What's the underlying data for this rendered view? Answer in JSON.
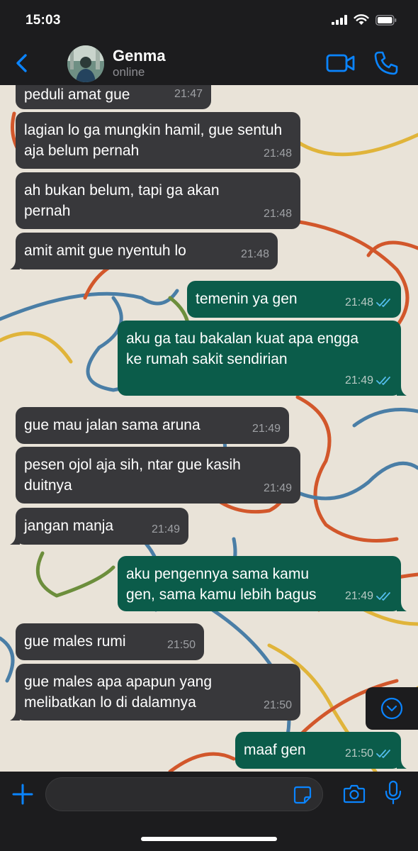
{
  "status_bar": {
    "time": "15:03"
  },
  "header": {
    "contact_name": "Genma",
    "contact_status": "online"
  },
  "messages": [
    {
      "dir": "in",
      "text": "peduli amat gue",
      "time": "21:47"
    },
    {
      "dir": "in",
      "text": "lagian lo ga mungkin hamil, gue sentuh aja belum pernah",
      "time": "21:48"
    },
    {
      "dir": "in",
      "text": "ah bukan belum, tapi ga akan pernah",
      "time": "21:48"
    },
    {
      "dir": "in",
      "text": "amit amit gue nyentuh lo",
      "time": "21:48"
    },
    {
      "dir": "out",
      "text": "temenin ya gen",
      "time": "21:48",
      "read": true
    },
    {
      "dir": "out",
      "text": "aku ga tau bakalan kuat apa engga ke rumah sakit sendirian",
      "time": "21:49",
      "read": true
    },
    {
      "dir": "in",
      "text": "gue mau jalan sama aruna",
      "time": "21:49"
    },
    {
      "dir": "in",
      "text": "pesen ojol aja sih, ntar gue kasih duitnya",
      "time": "21:49"
    },
    {
      "dir": "in",
      "text": "jangan manja",
      "time": "21:49"
    },
    {
      "dir": "out",
      "text": "aku pengennya sama kamu gen, sama kamu lebih bagus",
      "time": "21:49",
      "read": true
    },
    {
      "dir": "in",
      "text": "gue males rumi",
      "time": "21:50"
    },
    {
      "dir": "in",
      "text": "gue males apa apapun yang melibatkan lo di dalamnya",
      "time": "21:50"
    },
    {
      "dir": "out",
      "text": "maaf gen",
      "time": "21:50",
      "read": true
    }
  ],
  "input": {
    "placeholder": ""
  },
  "icons": {
    "back": "chevron-left-icon",
    "video": "video-camera-icon",
    "call": "phone-icon",
    "scroll_down": "chevron-down-circle-icon",
    "plus": "plus-icon",
    "sticker": "sticker-icon",
    "camera": "camera-icon",
    "mic": "microphone-icon"
  },
  "colors": {
    "accent": "#0a84ff",
    "incoming_bubble": "#38383b",
    "outgoing_bubble": "#0b5c4a",
    "read_ticks": "#53bdeb",
    "bar_background": "#1c1c1e",
    "wallpaper_background": "#e9e3d8"
  }
}
